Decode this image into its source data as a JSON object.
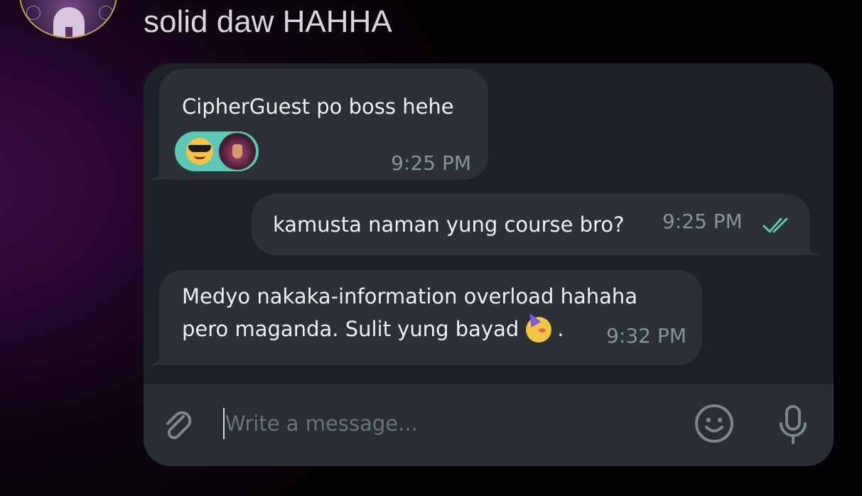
{
  "header": {
    "avatar_icon": "user-avatar-icon",
    "message": "solid daw HAHHA"
  },
  "chat": {
    "messages": [
      {
        "direction": "incoming",
        "text": "CipherGuest po boss hehe",
        "stickers": [
          "smiling-face-with-sunglasses-emoji",
          "beast-mask-custom-emoji"
        ],
        "time": "9:25 PM"
      },
      {
        "direction": "outgoing",
        "text": "kamusta naman yung course bro?",
        "time": "9:25 PM",
        "status_icon": "double-check-read-icon"
      },
      {
        "direction": "incoming",
        "lines": [
          "Medyo nakaka-information overload hahaha",
          "pero maganda. Sulit yung bayad"
        ],
        "trailing_emoji": "partying-face-emoji",
        "trailing_text": ".",
        "time": "9:32 PM"
      }
    ]
  },
  "composer": {
    "placeholder": "Write a message...",
    "value": "",
    "attach_icon": "paperclip-icon",
    "emoji_icon": "smiley-icon",
    "mic_icon": "microphone-icon"
  },
  "colors": {
    "chat_bg": "#1d2128",
    "bubble_bg": "#2c3037",
    "composer_bg": "#292d34",
    "time_color": "#8a929c",
    "read_check_color": "#5ac7b7",
    "sticker_bg": "#5ac7b7"
  }
}
